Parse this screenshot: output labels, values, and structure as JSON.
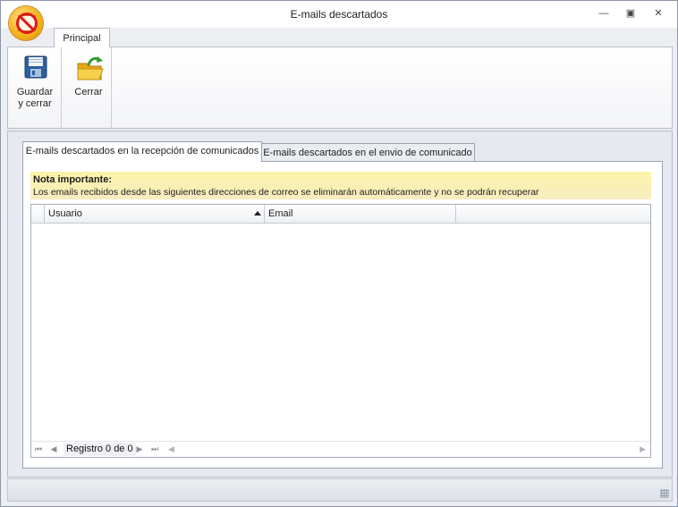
{
  "window": {
    "title": "E-mails descartados",
    "controls": [
      "minimize",
      "restore",
      "close"
    ]
  },
  "ribbon": {
    "tabs": [
      {
        "label": "Principal",
        "active": true
      }
    ],
    "buttons": [
      {
        "label_line1": "Guardar",
        "label_line2": "y cerrar",
        "icon": "save-disk-icon"
      },
      {
        "label": "Cerrar",
        "icon": "folder-exit-icon"
      }
    ]
  },
  "tabs": [
    {
      "label": "E-mails descartados en la recepción de comunicados",
      "active": true
    },
    {
      "label": "E-mails descartados en el envio de comunicado",
      "active": false
    }
  ],
  "note": {
    "title": "Nota importante:",
    "text": "Los emails recibidos desde las siguientes direcciones de correo se eliminarán automáticamente y no se podrán recuperar",
    "background": "#fbf4a8"
  },
  "grid": {
    "columns": [
      {
        "label": "Usuario",
        "sort": "ascending"
      },
      {
        "label": "Email"
      }
    ],
    "rows": [],
    "footer": {
      "record_text": "Registro 0 de 0"
    }
  }
}
